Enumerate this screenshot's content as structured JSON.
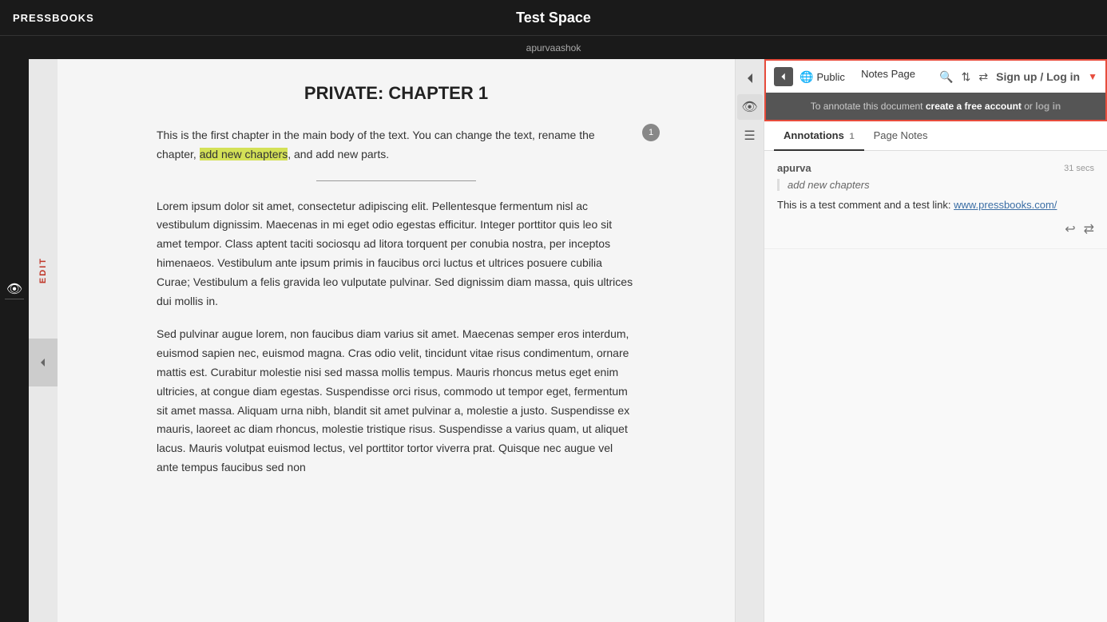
{
  "app": {
    "logo": "PRESSBOOKS",
    "title": "Test Space",
    "subtitle": "apurvaashok"
  },
  "document": {
    "chapter_title": "PRIVATE: CHAPTER 1",
    "first_para_before_highlight": "This is the first chapter in the main body of the text. You can change the text, rename the chapter, ",
    "highlight_text": "add new chapters",
    "first_para_after_highlight": ", and add new parts.",
    "annotation_count": "1",
    "lorem_1": "Lorem ipsum dolor sit amet, consectetur adipiscing elit. Pellentesque fermentum nisl ac vestibulum dignissim. Maecenas in mi eget odio egestas efficitur. Integer porttitor quis leo sit amet tempor. Class aptent taciti sociosqu ad litora torquent per conubia nostra, per inceptos himenaeos. Vestibulum ante ipsum primis in faucibus orci luctus et ultrices posuere cubilia Curae; Vestibulum a felis gravida leo vulputate pulvinar. Sed dignissim diam massa, quis ultrices dui mollis in.",
    "lorem_2": "Sed pulvinar augue lorem, non faucibus diam varius sit amet. Maecenas semper eros interdum, euismod sapien nec, euismod magna. Cras odio velit, tincidunt vitae risus condimentum, ornare mattis est. Curabitur molestie nisi sed massa mollis tempus. Mauris rhoncus metus eget enim ultricies, at congue diam egestas. Suspendisse orci risus, commodo ut tempor eget, fermentum sit amet massa. Aliquam urna nibh, blandit sit amet pulvinar a, molestie a justo. Suspendisse ex mauris, laoreet ac diam rhoncus, molestie tristique risus. Suspendisse a varius quam, ut aliquet lacus. Mauris volutpat euismod lectus, vel porttitor tortor viverra prat. Quisque nec augue vel ante tempus faucibus sed non",
    "edit_label": "EDIT"
  },
  "hypothesis": {
    "public_label": "Public",
    "signup_login": "Sign up / Log in",
    "annotate_message_before": "To annotate this document ",
    "annotate_create": "create a free account",
    "annotate_or": " or ",
    "annotate_login": "log in",
    "tabs": [
      {
        "label": "Annotations",
        "count": "1",
        "active": true
      },
      {
        "label": "Page Notes",
        "count": "",
        "active": false
      }
    ],
    "annotation": {
      "user": "apurva",
      "time": "31 secs",
      "quote": "add new chapters",
      "comment_before": "This is a test comment and a test link: ",
      "link_text": "www.pressbooks.com/",
      "link_url": "http://www.pressbooks.com/"
    },
    "notes_page_label": "Notes Page"
  }
}
